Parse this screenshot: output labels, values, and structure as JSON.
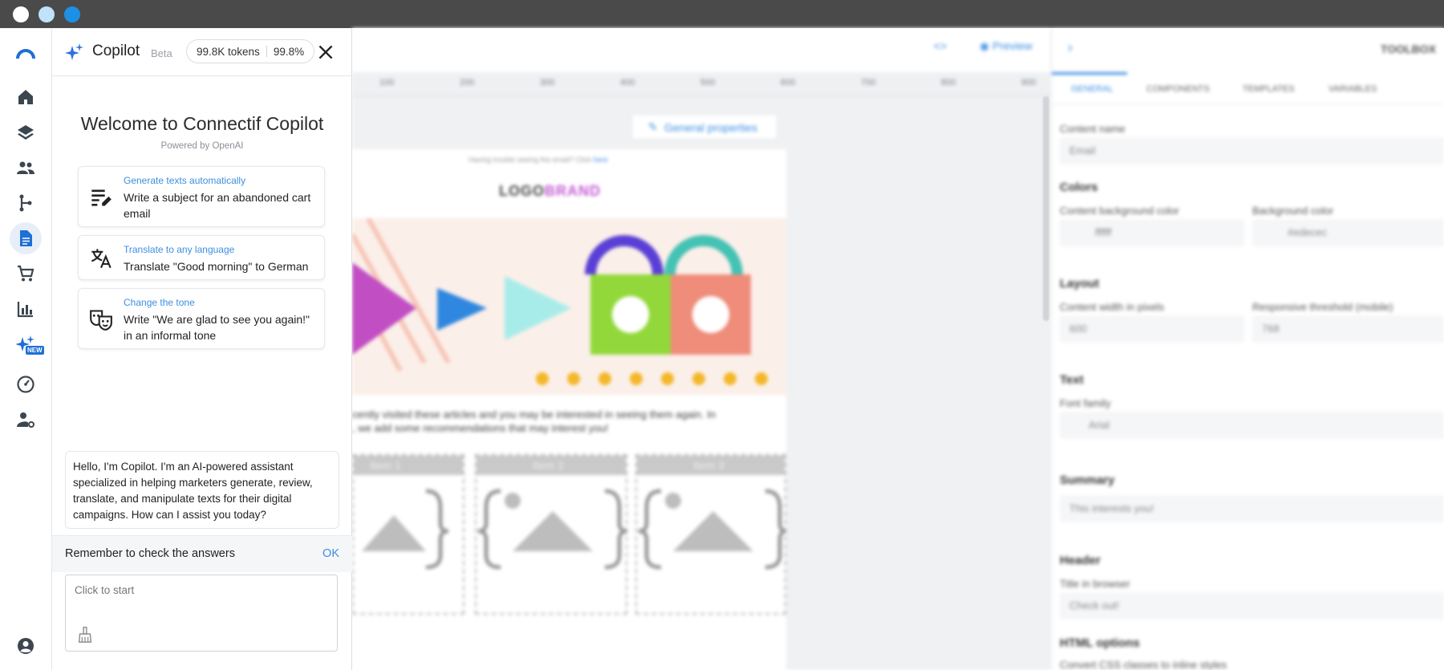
{
  "window": {
    "dots": [
      "#ffffff",
      "#bfe3fb",
      "#1e8fe6"
    ]
  },
  "rail": {
    "items": [
      {
        "icon": "logo-arc-icon"
      },
      {
        "icon": "home-icon"
      },
      {
        "icon": "layers-icon"
      },
      {
        "icon": "users-icon"
      },
      {
        "icon": "workflow-icon"
      },
      {
        "icon": "document-icon",
        "active": true
      },
      {
        "icon": "cart-icon"
      },
      {
        "icon": "bar-chart-icon"
      },
      {
        "icon": "copilot-sparkle-icon",
        "badge": "NEW"
      },
      {
        "icon": "gauge-icon"
      },
      {
        "icon": "user-settings-icon"
      },
      {
        "icon": "account-icon"
      }
    ],
    "accent": "#1e6fd6"
  },
  "copilot": {
    "title": "Copilot",
    "beta": "Beta",
    "tokens": "99.8K tokens",
    "percent": "99.8%",
    "welcome": "Welcome to Connectif Copilot",
    "powered_by": "Powered by OpenAI",
    "suggestions": [
      {
        "category": "Generate texts automatically",
        "text": "Write a subject for an abandoned cart email",
        "icon": "text-lines-pen-icon"
      },
      {
        "category": "Translate to any language",
        "text": "Translate \"Good morning\" to German",
        "icon": "translate-icon"
      },
      {
        "category": "Change the tone",
        "text": "Write \"We are glad to see you again!\" in an informal tone",
        "icon": "theater-masks-icon"
      }
    ],
    "message": "Hello, I'm Copilot. I'm an AI-powered assistant specialized in helping marketers generate, review, translate, and manipulate texts for their digital campaigns. How can I assist you today?",
    "reminder": "Remember to check the answers",
    "ok": "OK",
    "input_placeholder": "Click to start",
    "link_color": "#3d8ee0"
  },
  "editor": {
    "preview": "Preview",
    "general_properties": "General properties",
    "trouble_text": "Having trouble seeing the email? Click",
    "trouble_link": "here",
    "logo_a": "LOGO",
    "logo_b": "BRAND",
    "ruler": [
      "100",
      "200",
      "300",
      "400",
      "500",
      "600",
      "700",
      "800",
      "900"
    ],
    "body_line1": "cently visited these articles and you may be interested in seeing them again. In",
    "body_line2": ", we add some recommendations that may interest you!",
    "items": [
      "Item 1",
      "Item 2",
      "Item 3"
    ]
  },
  "toolbox": {
    "title": "TOOLBOX",
    "tabs": [
      "GENERAL",
      "COMPONENTS",
      "TEMPLATES",
      "VARIABLES"
    ],
    "content_name_label": "Content name",
    "content_name": "Email",
    "colors": "Colors",
    "content_bg_label": "Content background color",
    "content_bg": "ffffff",
    "bg_label": "Background color",
    "bg": "#edecec",
    "layout": "Layout",
    "width_label": "Content width in pixels",
    "width": "600",
    "threshold_label": "Responsive threshold (mobile)",
    "threshold": "768",
    "text": "Text",
    "font_family_label": "Font family",
    "font_family": "Arial",
    "summary": "Summary",
    "summary_value": "This interests you!",
    "header": "Header",
    "title_browser_label": "Title in browser",
    "title_browser": "Check out!",
    "html_options": "HTML options",
    "convert_css": "Convert CSS classes to inline styles"
  }
}
